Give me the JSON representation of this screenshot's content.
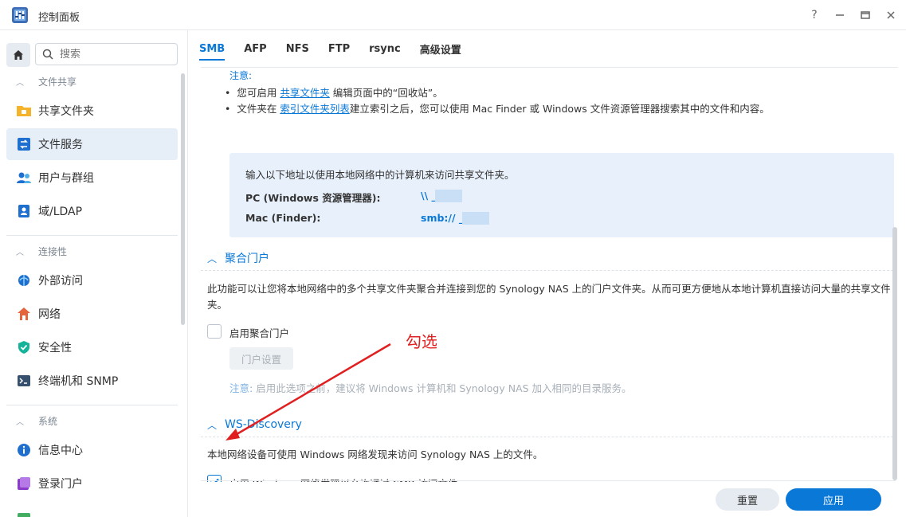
{
  "window": {
    "title": "控制面板",
    "help": "?",
    "minimize": "—",
    "maximize": "□",
    "close": "✕"
  },
  "sidebar": {
    "search_placeholder": "搜索",
    "sections": [
      {
        "label": "文件共享"
      },
      {
        "label": "连接性"
      },
      {
        "label": "系统"
      }
    ],
    "items": [
      {
        "label": "共享文件夹",
        "icon": "folder-icon"
      },
      {
        "label": "文件服务",
        "icon": "file-services-icon"
      },
      {
        "label": "用户与群组",
        "icon": "users-icon"
      },
      {
        "label": "域/LDAP",
        "icon": "domain-icon"
      },
      {
        "label": "外部访问",
        "icon": "external-access-icon"
      },
      {
        "label": "网络",
        "icon": "network-icon"
      },
      {
        "label": "安全性",
        "icon": "shield-icon"
      },
      {
        "label": "终端机和 SNMP",
        "icon": "terminal-icon"
      },
      {
        "label": "信息中心",
        "icon": "info-icon"
      },
      {
        "label": "登录门户",
        "icon": "login-portal-icon"
      }
    ]
  },
  "tabs": [
    "SMB",
    "AFP",
    "NFS",
    "FTP",
    "rsync",
    "高级设置"
  ],
  "notes": {
    "title": "注意:",
    "line1_pre": "您可启用 ",
    "line1_link": "共享文件夹",
    "line1_post": " 编辑页面中的“回收站”。",
    "line2_pre": "文件夹在 ",
    "line2_link": "索引文件夹列表",
    "line2_post": "建立索引之后，您可以使用 Mac Finder 或 Windows 文件资源管理器搜索其中的文件和内容。"
  },
  "address_box": {
    "intro": "输入以下地址以使用本地网络中的计算机来访问共享文件夹。",
    "pc_label": "PC (Windows 资源管理器):",
    "pc_value": "\\\\      _nas",
    "mac_label": "Mac (Finder):",
    "mac_value": "smb://      _nas"
  },
  "aggregation": {
    "heading": "聚合门户",
    "desc": "此功能可以让您将本地网络中的多个共享文件夹聚合并连接到您的 Synology NAS 上的门户文件夹。从而可更方便地从本地计算机直接访问大量的共享文件夹。",
    "enable_label": "启用聚合门户",
    "enabled": false,
    "settings_button": "门户设置",
    "note_prefix": "注意:",
    "note_text": " 启用此选项之前，建议将 Windows 计算机和 Synology NAS 加入相同的目录服务。"
  },
  "ws_discovery": {
    "heading": "WS-Discovery",
    "desc": "本地网络设备可使用 Windows 网络发现来访问 Synology NAS 上的文件。",
    "enable_label": "启用 Windows 网络发现以允许通过 SMB 访问文件",
    "enabled": true
  },
  "footer": {
    "reset": "重置",
    "apply": "应用"
  },
  "annotation": {
    "text": "勾选",
    "color": "#e02020"
  },
  "colors": {
    "accent": "#0a78d7",
    "active_bg": "#e6eef8",
    "info_bg": "#e8f1fb"
  }
}
